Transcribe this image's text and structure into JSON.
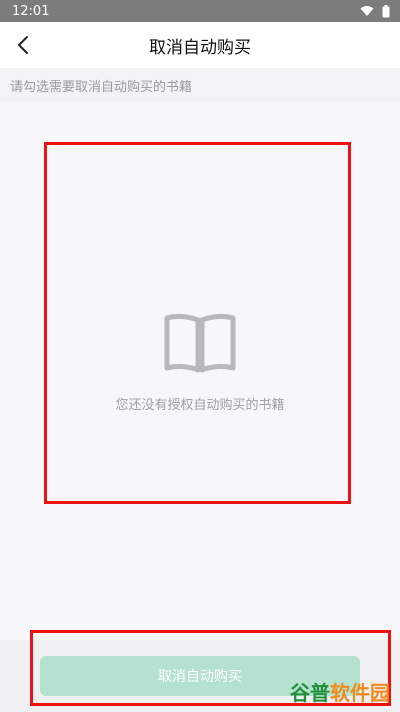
{
  "status_bar": {
    "time": "12:01"
  },
  "nav": {
    "title": "取消自动购买",
    "back_icon": "chevron-left-icon"
  },
  "hint": "请勾选需要取消自动购买的书籍",
  "empty_state": {
    "icon": "open-book-icon",
    "message": "您还没有授权自动购买的书籍"
  },
  "footer": {
    "button_label": "取消自动购买"
  },
  "watermark": {
    "part1": "谷普",
    "part2": "软件园"
  },
  "colors": {
    "accent_disabled": "#b4e2cf",
    "highlight_box": "#ee1111",
    "watermark_green": "#1f8f3a",
    "watermark_orange": "#f08a1c"
  }
}
